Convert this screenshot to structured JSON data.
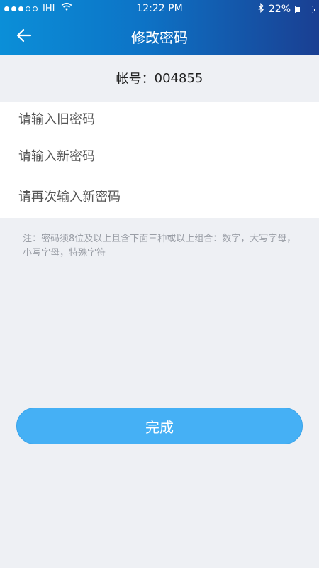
{
  "status_bar": {
    "carrier": "IHI",
    "time": "12:22 PM",
    "battery_text": "22%",
    "battery_level": 0.22
  },
  "nav": {
    "title": "修改密码"
  },
  "account": {
    "label": "帐号：",
    "value": "004855"
  },
  "form": {
    "old_password_placeholder": "请输入旧密码",
    "new_password_placeholder": "请输入新密码",
    "confirm_password_placeholder": "请再次输入新密码"
  },
  "note": "注：密码须8位及以上且含下面三种或以上组合：数字，大写字母，小写字母，特殊字符",
  "done_button": "完成",
  "colors": {
    "header_start": "#0b8fd8",
    "header_end": "#1a3f92",
    "button": "#45b0f5",
    "background": "#eef0f4"
  }
}
